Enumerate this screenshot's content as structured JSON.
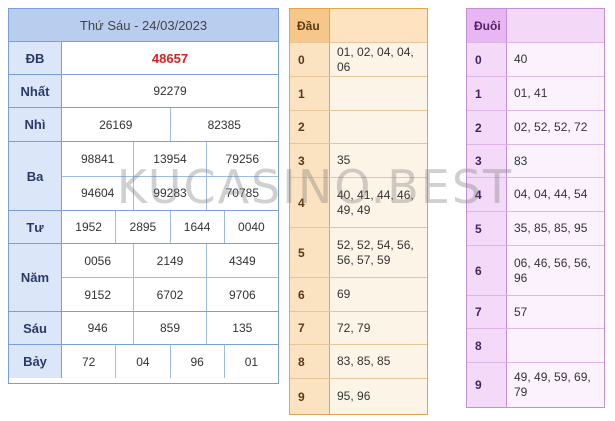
{
  "results": {
    "title": "Thứ Sáu - 24/03/2023",
    "rows": [
      {
        "label": "ĐB",
        "lines": [
          [
            "48657"
          ]
        ]
      },
      {
        "label": "Nhất",
        "lines": [
          [
            "92279"
          ]
        ]
      },
      {
        "label": "Nhì",
        "lines": [
          [
            "26169",
            "82385"
          ]
        ]
      },
      {
        "label": "Ba",
        "lines": [
          [
            "98841",
            "13954",
            "79256"
          ],
          [
            "94604",
            "99283",
            "70785"
          ]
        ]
      },
      {
        "label": "Tư",
        "lines": [
          [
            "1952",
            "2895",
            "1644",
            "0040"
          ]
        ]
      },
      {
        "label": "Năm",
        "lines": [
          [
            "0056",
            "2149",
            "4349"
          ],
          [
            "9152",
            "6702",
            "9706"
          ]
        ]
      },
      {
        "label": "Sáu",
        "lines": [
          [
            "946",
            "859",
            "135"
          ]
        ]
      },
      {
        "label": "Bảy",
        "lines": [
          [
            "72",
            "04",
            "96",
            "01"
          ]
        ]
      }
    ],
    "special_color": "#e02020"
  },
  "dau": {
    "header": "Đầu",
    "rows": [
      {
        "key": "0",
        "value": "01, 02, 04, 04, 06"
      },
      {
        "key": "1",
        "value": ""
      },
      {
        "key": "2",
        "value": ""
      },
      {
        "key": "3",
        "value": "35"
      },
      {
        "key": "4",
        "value": "40, 41, 44, 46, 49, 49"
      },
      {
        "key": "5",
        "value": "52, 52, 54, 56, 56, 57, 59"
      },
      {
        "key": "6",
        "value": "69"
      },
      {
        "key": "7",
        "value": "72, 79"
      },
      {
        "key": "8",
        "value": "83, 85, 85"
      },
      {
        "key": "9",
        "value": "95, 96"
      }
    ]
  },
  "duoi": {
    "header": "Đuôi",
    "rows": [
      {
        "key": "0",
        "value": "40"
      },
      {
        "key": "1",
        "value": "01, 41"
      },
      {
        "key": "2",
        "value": "02, 52, 52, 72"
      },
      {
        "key": "3",
        "value": "83"
      },
      {
        "key": "4",
        "value": "04, 04, 44, 54"
      },
      {
        "key": "5",
        "value": "35, 85, 85, 95"
      },
      {
        "key": "6",
        "value": "06, 46, 56, 56, 96"
      },
      {
        "key": "7",
        "value": "57"
      },
      {
        "key": "8",
        "value": ""
      },
      {
        "key": "9",
        "value": "49, 49, 59, 69, 79"
      }
    ]
  },
  "watermark": "KUCASINO.BEST"
}
